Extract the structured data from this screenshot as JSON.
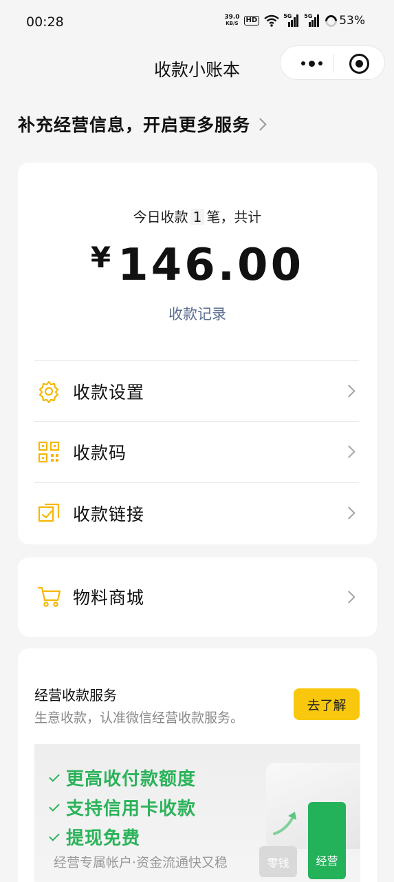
{
  "status_bar": {
    "time": "00:28",
    "net_speed_value": "39.0",
    "net_speed_unit": "KB/S",
    "hd_badge": "HD",
    "sim1_tag": "5G",
    "sim2_tag": "5G",
    "battery": "53%"
  },
  "nav": {
    "title": "收款小账本"
  },
  "promo": {
    "text": "补充经营信息，开启更多服务"
  },
  "summary": {
    "prefix": "今日收款",
    "count": "1",
    "suffix": "笔，共计",
    "currency": "¥",
    "amount": "146.00",
    "record_link": "收款记录"
  },
  "menu": {
    "items": [
      {
        "label": "收款设置",
        "icon": "gear-icon"
      },
      {
        "label": "收款码",
        "icon": "qr-code-icon"
      },
      {
        "label": "收款链接",
        "icon": "link-icon"
      }
    ]
  },
  "shop": {
    "label": "物料商城",
    "icon": "cart-icon"
  },
  "service": {
    "title": "经营收款服务",
    "subtitle": "生意收款，认准微信经营收款服务。",
    "button": "去了解",
    "features": [
      "更高收付款额度",
      "支持信用卡收款",
      "提现免费"
    ],
    "footer": "经营专属帐户·资金流通快又稳",
    "bar_small": "零钱",
    "bar_big": "经营"
  },
  "colors": {
    "accent_yellow": "#f9c80e",
    "link_blue": "#5a6d8f",
    "green": "#23b15a"
  }
}
